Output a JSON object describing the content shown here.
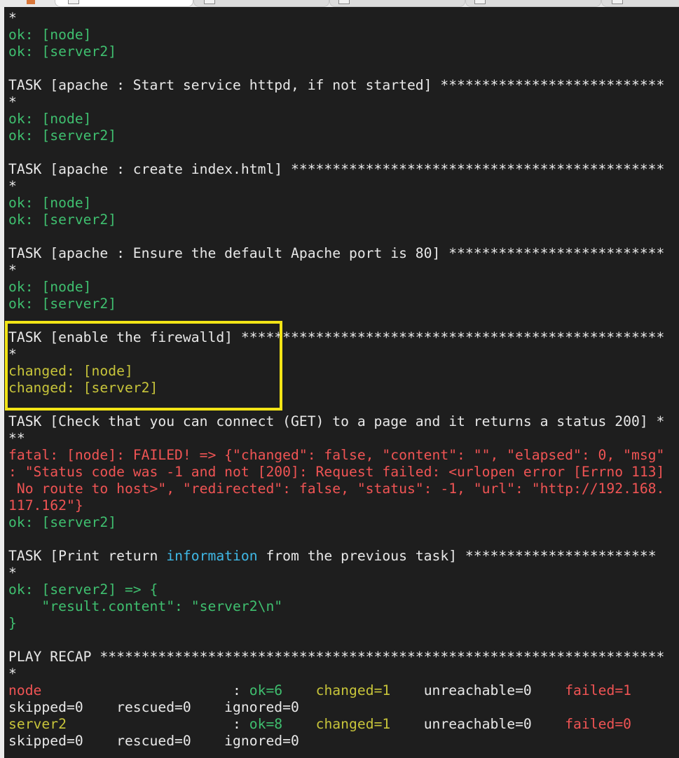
{
  "window": {
    "tabs": [
      {
        "label": "",
        "active": true
      },
      {
        "label": "",
        "active": false
      },
      {
        "label": "",
        "active": false
      },
      {
        "label": "",
        "active": false
      },
      {
        "label": "",
        "active": false
      }
    ]
  },
  "colors": {
    "background": "#1e1e1e",
    "ok": "#3fbf6f",
    "changed": "#c7c43a",
    "failed": "#f05454",
    "highlight": "#f2e416"
  },
  "terminal": {
    "lines": [
      [
        {
          "t": "*",
          "c": "white"
        }
      ],
      [
        {
          "t": "ok: [node]",
          "c": "green"
        }
      ],
      [
        {
          "t": "ok: [server2]",
          "c": "green"
        }
      ],
      [],
      [
        {
          "t": "TASK [apache : Start service httpd, if not started] ***************************",
          "c": "white"
        }
      ],
      [
        {
          "t": "*",
          "c": "white"
        }
      ],
      [
        {
          "t": "ok: [node]",
          "c": "green"
        }
      ],
      [
        {
          "t": "ok: [server2]",
          "c": "green"
        }
      ],
      [],
      [
        {
          "t": "TASK [apache : create index.html] *********************************************",
          "c": "white"
        }
      ],
      [
        {
          "t": "*",
          "c": "white"
        }
      ],
      [
        {
          "t": "ok: [node]",
          "c": "green"
        }
      ],
      [
        {
          "t": "ok: [server2]",
          "c": "green"
        }
      ],
      [],
      [
        {
          "t": "TASK [apache : Ensure the default Apache port is 80] **************************",
          "c": "white"
        }
      ],
      [
        {
          "t": "*",
          "c": "white"
        }
      ],
      [
        {
          "t": "ok: [node]",
          "c": "green"
        }
      ],
      [
        {
          "t": "ok: [server2]",
          "c": "green"
        }
      ],
      [],
      [
        {
          "t": "TASK [enable the firewalld] ***************************************************",
          "c": "white"
        }
      ],
      [
        {
          "t": "*",
          "c": "white"
        }
      ],
      [
        {
          "t": "changed: [node]",
          "c": "yellow"
        }
      ],
      [
        {
          "t": "changed: [server2]",
          "c": "yellow"
        }
      ],
      [],
      [
        {
          "t": "TASK [Check that you can connect (GET) to a page and it returns a status 200] *",
          "c": "white"
        }
      ],
      [
        {
          "t": "**",
          "c": "white"
        }
      ],
      [
        {
          "t": "fatal: [node]: FAILED! => {\"changed\": false, \"content\": \"\", \"elapsed\": 0, \"msg\"",
          "c": "red"
        }
      ],
      [
        {
          "t": ": \"Status code was -1 and not [200]: Request failed: <urlopen error [Errno 113]",
          "c": "red"
        }
      ],
      [
        {
          "t": " No route to host>\", \"redirected\": false, \"status\": -1, \"url\": \"http://192.168.",
          "c": "red"
        }
      ],
      [
        {
          "t": "117.162\"}",
          "c": "red"
        }
      ],
      [
        {
          "t": "ok: [server2]",
          "c": "green"
        }
      ],
      [],
      [
        {
          "t": "TASK [Print return ",
          "c": "white"
        },
        {
          "t": "information",
          "c": "cyan"
        },
        {
          "t": " from the previous task] ***********************",
          "c": "white"
        }
      ],
      [
        {
          "t": "*",
          "c": "white"
        }
      ],
      [
        {
          "t": "ok: [server2] => {",
          "c": "green"
        }
      ],
      [
        {
          "t": "    \"result.content\": \"server2\\n\"",
          "c": "green"
        }
      ],
      [
        {
          "t": "}",
          "c": "green"
        }
      ],
      [],
      [
        {
          "t": "PLAY RECAP ********************************************************************",
          "c": "white"
        }
      ],
      [
        {
          "t": "*",
          "c": "white"
        }
      ],
      [
        {
          "t": "node",
          "c": "red"
        },
        {
          "t": "                       : ",
          "c": "white"
        },
        {
          "t": "ok=6",
          "c": "green"
        },
        {
          "t": "    ",
          "c": "white"
        },
        {
          "t": "changed=1",
          "c": "yellow"
        },
        {
          "t": "    unreachable=0    ",
          "c": "white"
        },
        {
          "t": "failed=1",
          "c": "red"
        }
      ],
      [
        {
          "t": "skipped=0    rescued=0    ignored=0",
          "c": "white"
        }
      ],
      [
        {
          "t": "server2",
          "c": "yellow"
        },
        {
          "t": "                    : ",
          "c": "white"
        },
        {
          "t": "ok=8",
          "c": "green"
        },
        {
          "t": "    ",
          "c": "white"
        },
        {
          "t": "changed=1",
          "c": "yellow"
        },
        {
          "t": "    unreachable=0    ",
          "c": "white"
        },
        {
          "t": "failed=0",
          "c": "red"
        }
      ],
      [
        {
          "t": "skipped=0    rescued=0    ignored=0",
          "c": "white"
        }
      ]
    ]
  }
}
